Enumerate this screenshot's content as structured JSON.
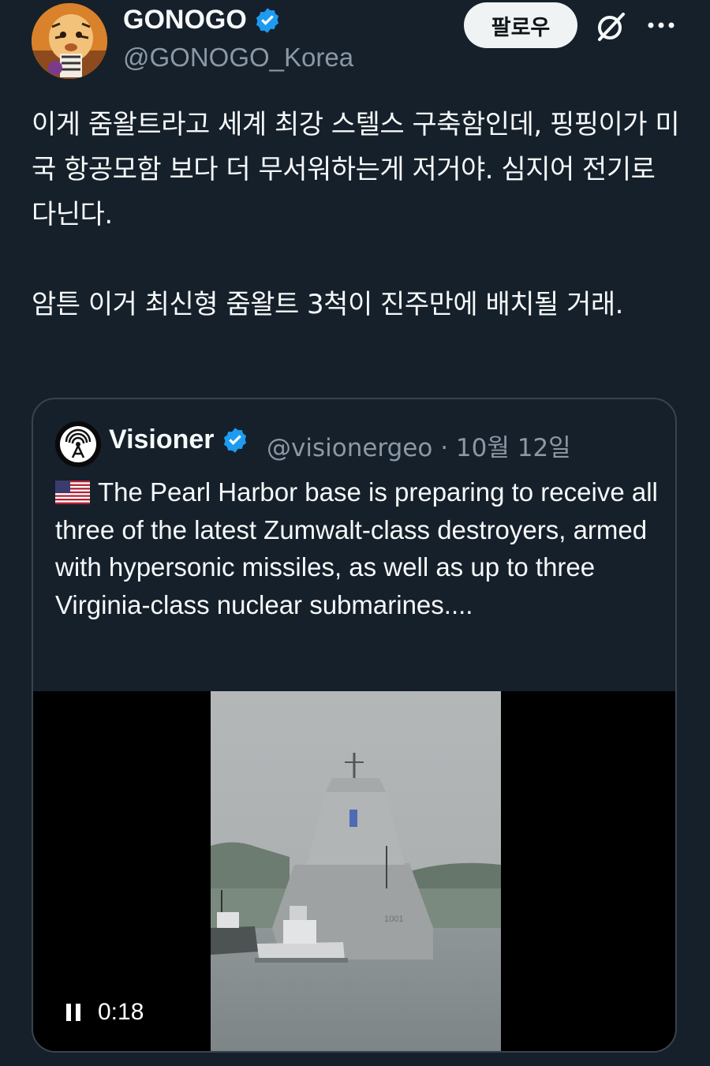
{
  "author": {
    "display_name": "GONOGO",
    "handle": "@GONOGO_Korea",
    "follow_label": "팔로우"
  },
  "tweet": {
    "paragraph1": "이게 줌왈트라고 세계 최강 스텔스 구축함인데, 핑핑이가 미국 항공모함 보다 더 무서워하는게 저거야.  심지어 전기로 다닌다.",
    "paragraph2": "암튼 이거 최신형 줌왈트 3척이 진주만에 배치될 거래."
  },
  "quote": {
    "display_name": "Visioner",
    "handle": "@visionergeo",
    "separator": "·",
    "date": "10월 12일",
    "text": "The Pearl Harbor base is preparing to receive all three of the latest Zumwalt-class destroyers, armed with hypersonic missiles, as well as up to three Virginia-class nuclear submarines....",
    "video_time": "0:18"
  },
  "colors": {
    "background": "#15202b",
    "verified": "#1d9bf0",
    "secondary_text": "#8b98a5",
    "border": "#38444d"
  },
  "icons": {
    "verified": "verified-badge-icon",
    "grok": "grok-icon",
    "more": "more-icon",
    "flag": "us-flag-icon",
    "pause": "pause-icon"
  }
}
